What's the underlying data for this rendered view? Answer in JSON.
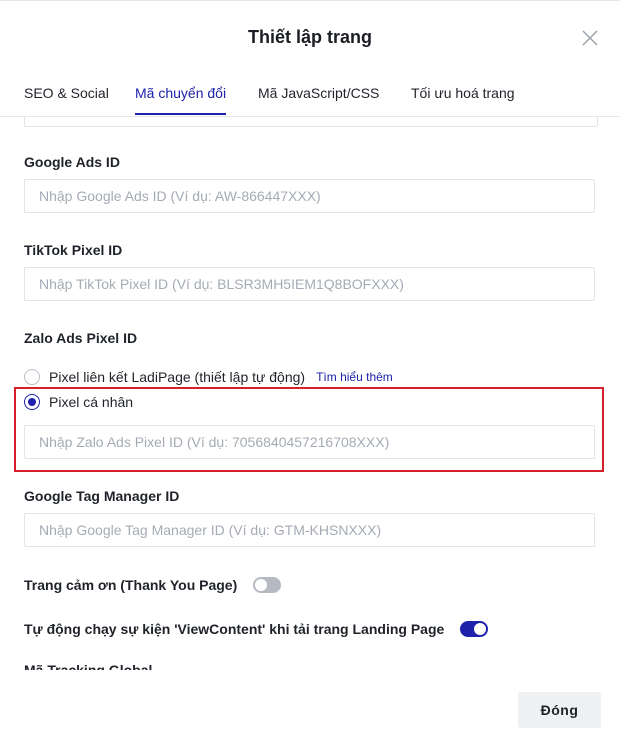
{
  "modal": {
    "title": "Thiết lập trang"
  },
  "tabs": [
    {
      "label": "SEO & Social",
      "active": false
    },
    {
      "label": "Mã chuyển đổi",
      "active": true
    },
    {
      "label": "Mã JavaScript/CSS",
      "active": false
    },
    {
      "label": "Tối ưu hoá trang",
      "active": false
    }
  ],
  "fields": {
    "google_ads": {
      "label": "Google Ads ID",
      "value": "",
      "placeholder": "Nhập Google Ads ID (Ví dụ: AW-866447XXX)"
    },
    "tiktok_pixel": {
      "label": "TikTok Pixel ID",
      "value": "",
      "placeholder": "Nhập TikTok Pixel ID (Ví dụ: BLSR3MH5IEM1Q8BOFXXX)"
    },
    "zalo_ads": {
      "label": "Zalo Ads Pixel ID",
      "options": [
        {
          "label": "Pixel liên kết LadiPage (thiết lập tự động)",
          "checked": false
        },
        {
          "label": "Pixel cá nhân",
          "checked": true
        }
      ],
      "learn_more": "Tìm hiểu thêm",
      "value": "",
      "placeholder": "Nhập Zalo Ads Pixel ID (Ví dụ: 7056840457216708XXX)"
    },
    "gtm": {
      "label": "Google Tag Manager ID",
      "value": "",
      "placeholder": "Nhập Google Tag Manager ID (Ví dụ: GTM-KHSNXXX)"
    }
  },
  "toggles": {
    "thank_you_page": {
      "label": "Trang cảm ơn (Thank You Page)",
      "on": false
    },
    "auto_view_content": {
      "label": "Tự động chạy sự kiện 'ViewContent' khi tải trang Landing Page",
      "on": true
    }
  },
  "cut_off_label": "Mã Tracking Global",
  "footer": {
    "close_label": "Đóng"
  },
  "colors": {
    "accent": "#1e22aa",
    "highlight": "#d8202a",
    "toggle_off": "#b5bac2"
  },
  "icons": {
    "close": "close-icon"
  }
}
